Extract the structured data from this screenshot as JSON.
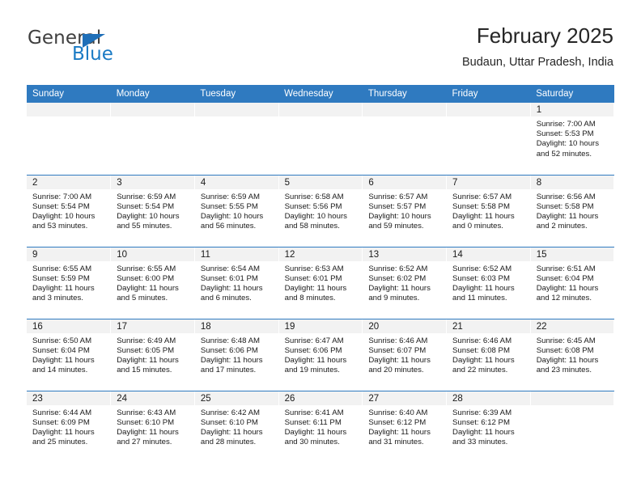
{
  "brand": {
    "name_part1": "General",
    "name_part2": "Blue",
    "flag_icon": "blue-triangle-flag-icon"
  },
  "header": {
    "title": "February 2025",
    "subtitle": "Budaun, Uttar Pradesh, India"
  },
  "colors": {
    "header_blue": "#2f7ac0",
    "logo_blue": "#1a7ac4",
    "daynum_band": "#f2f2f2",
    "text": "#1a1a1a"
  },
  "weekday_headers": [
    "Sunday",
    "Monday",
    "Tuesday",
    "Wednesday",
    "Thursday",
    "Friday",
    "Saturday"
  ],
  "labels": {
    "sunrise_prefix": "Sunrise: ",
    "sunset_prefix": "Sunset: ",
    "daylight_prefix": "Daylight: "
  },
  "weeks": [
    [
      {
        "blank": true,
        "day": ""
      },
      {
        "blank": true,
        "day": ""
      },
      {
        "blank": true,
        "day": ""
      },
      {
        "blank": true,
        "day": ""
      },
      {
        "blank": true,
        "day": ""
      },
      {
        "blank": true,
        "day": ""
      },
      {
        "blank": false,
        "day": "1",
        "sunrise": "Sunrise: 7:00 AM",
        "sunset": "Sunset: 5:53 PM",
        "daylight": "Daylight: 10 hours and 52 minutes."
      }
    ],
    [
      {
        "blank": false,
        "day": "2",
        "sunrise": "Sunrise: 7:00 AM",
        "sunset": "Sunset: 5:54 PM",
        "daylight": "Daylight: 10 hours and 53 minutes."
      },
      {
        "blank": false,
        "day": "3",
        "sunrise": "Sunrise: 6:59 AM",
        "sunset": "Sunset: 5:54 PM",
        "daylight": "Daylight: 10 hours and 55 minutes."
      },
      {
        "blank": false,
        "day": "4",
        "sunrise": "Sunrise: 6:59 AM",
        "sunset": "Sunset: 5:55 PM",
        "daylight": "Daylight: 10 hours and 56 minutes."
      },
      {
        "blank": false,
        "day": "5",
        "sunrise": "Sunrise: 6:58 AM",
        "sunset": "Sunset: 5:56 PM",
        "daylight": "Daylight: 10 hours and 58 minutes."
      },
      {
        "blank": false,
        "day": "6",
        "sunrise": "Sunrise: 6:57 AM",
        "sunset": "Sunset: 5:57 PM",
        "daylight": "Daylight: 10 hours and 59 minutes."
      },
      {
        "blank": false,
        "day": "7",
        "sunrise": "Sunrise: 6:57 AM",
        "sunset": "Sunset: 5:58 PM",
        "daylight": "Daylight: 11 hours and 0 minutes."
      },
      {
        "blank": false,
        "day": "8",
        "sunrise": "Sunrise: 6:56 AM",
        "sunset": "Sunset: 5:58 PM",
        "daylight": "Daylight: 11 hours and 2 minutes."
      }
    ],
    [
      {
        "blank": false,
        "day": "9",
        "sunrise": "Sunrise: 6:55 AM",
        "sunset": "Sunset: 5:59 PM",
        "daylight": "Daylight: 11 hours and 3 minutes."
      },
      {
        "blank": false,
        "day": "10",
        "sunrise": "Sunrise: 6:55 AM",
        "sunset": "Sunset: 6:00 PM",
        "daylight": "Daylight: 11 hours and 5 minutes."
      },
      {
        "blank": false,
        "day": "11",
        "sunrise": "Sunrise: 6:54 AM",
        "sunset": "Sunset: 6:01 PM",
        "daylight": "Daylight: 11 hours and 6 minutes."
      },
      {
        "blank": false,
        "day": "12",
        "sunrise": "Sunrise: 6:53 AM",
        "sunset": "Sunset: 6:01 PM",
        "daylight": "Daylight: 11 hours and 8 minutes."
      },
      {
        "blank": false,
        "day": "13",
        "sunrise": "Sunrise: 6:52 AM",
        "sunset": "Sunset: 6:02 PM",
        "daylight": "Daylight: 11 hours and 9 minutes."
      },
      {
        "blank": false,
        "day": "14",
        "sunrise": "Sunrise: 6:52 AM",
        "sunset": "Sunset: 6:03 PM",
        "daylight": "Daylight: 11 hours and 11 minutes."
      },
      {
        "blank": false,
        "day": "15",
        "sunrise": "Sunrise: 6:51 AM",
        "sunset": "Sunset: 6:04 PM",
        "daylight": "Daylight: 11 hours and 12 minutes."
      }
    ],
    [
      {
        "blank": false,
        "day": "16",
        "sunrise": "Sunrise: 6:50 AM",
        "sunset": "Sunset: 6:04 PM",
        "daylight": "Daylight: 11 hours and 14 minutes."
      },
      {
        "blank": false,
        "day": "17",
        "sunrise": "Sunrise: 6:49 AM",
        "sunset": "Sunset: 6:05 PM",
        "daylight": "Daylight: 11 hours and 15 minutes."
      },
      {
        "blank": false,
        "day": "18",
        "sunrise": "Sunrise: 6:48 AM",
        "sunset": "Sunset: 6:06 PM",
        "daylight": "Daylight: 11 hours and 17 minutes."
      },
      {
        "blank": false,
        "day": "19",
        "sunrise": "Sunrise: 6:47 AM",
        "sunset": "Sunset: 6:06 PM",
        "daylight": "Daylight: 11 hours and 19 minutes."
      },
      {
        "blank": false,
        "day": "20",
        "sunrise": "Sunrise: 6:46 AM",
        "sunset": "Sunset: 6:07 PM",
        "daylight": "Daylight: 11 hours and 20 minutes."
      },
      {
        "blank": false,
        "day": "21",
        "sunrise": "Sunrise: 6:46 AM",
        "sunset": "Sunset: 6:08 PM",
        "daylight": "Daylight: 11 hours and 22 minutes."
      },
      {
        "blank": false,
        "day": "22",
        "sunrise": "Sunrise: 6:45 AM",
        "sunset": "Sunset: 6:08 PM",
        "daylight": "Daylight: 11 hours and 23 minutes."
      }
    ],
    [
      {
        "blank": false,
        "day": "23",
        "sunrise": "Sunrise: 6:44 AM",
        "sunset": "Sunset: 6:09 PM",
        "daylight": "Daylight: 11 hours and 25 minutes."
      },
      {
        "blank": false,
        "day": "24",
        "sunrise": "Sunrise: 6:43 AM",
        "sunset": "Sunset: 6:10 PM",
        "daylight": "Daylight: 11 hours and 27 minutes."
      },
      {
        "blank": false,
        "day": "25",
        "sunrise": "Sunrise: 6:42 AM",
        "sunset": "Sunset: 6:10 PM",
        "daylight": "Daylight: 11 hours and 28 minutes."
      },
      {
        "blank": false,
        "day": "26",
        "sunrise": "Sunrise: 6:41 AM",
        "sunset": "Sunset: 6:11 PM",
        "daylight": "Daylight: 11 hours and 30 minutes."
      },
      {
        "blank": false,
        "day": "27",
        "sunrise": "Sunrise: 6:40 AM",
        "sunset": "Sunset: 6:12 PM",
        "daylight": "Daylight: 11 hours and 31 minutes."
      },
      {
        "blank": false,
        "day": "28",
        "sunrise": "Sunrise: 6:39 AM",
        "sunset": "Sunset: 6:12 PM",
        "daylight": "Daylight: 11 hours and 33 minutes."
      },
      {
        "blank": true,
        "day": ""
      }
    ]
  ]
}
